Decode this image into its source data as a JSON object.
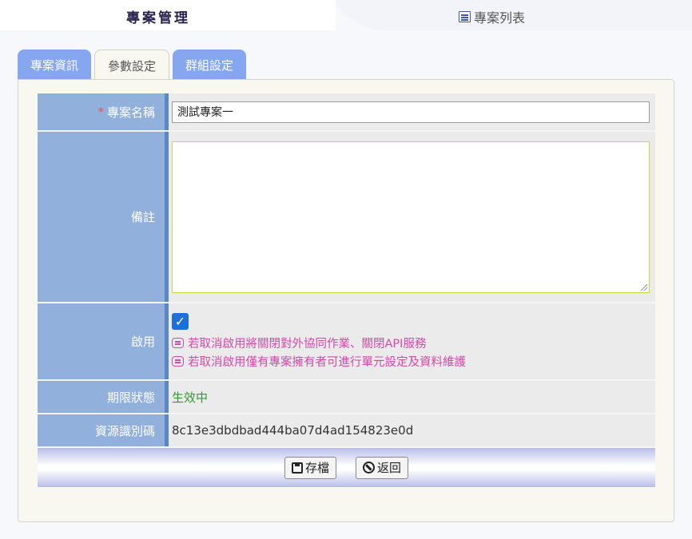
{
  "header": {
    "title": "專案管理",
    "list_link_label": "專案列表"
  },
  "tabs": [
    {
      "label": "專案資訊",
      "state": "inactive"
    },
    {
      "label": "參數設定",
      "state": "active"
    },
    {
      "label": "群組設定",
      "state": "inactive"
    }
  ],
  "form": {
    "name": {
      "required_mark": "*",
      "label": "專案名稱",
      "value": "測試專案一"
    },
    "remark": {
      "label": "備註",
      "value": ""
    },
    "enabled": {
      "label": "啟用",
      "checked": true,
      "notes": [
        "若取消啟用將關閉對外協同作業、關閉API服務",
        "若取消啟用僅有專案擁有者可進行單元設定及資料維護"
      ]
    },
    "expiry": {
      "label": "期限狀態",
      "value": "生效中"
    },
    "resource_id": {
      "label": "資源識別碼",
      "value": "8c13e3dbdbad444ba07d4ad154823e0d"
    }
  },
  "buttons": {
    "save_label": "存檔",
    "back_label": "返回"
  },
  "colors": {
    "tab_blue": "#86a7f0",
    "label_bg": "#91b0dc",
    "note_pink": "#d24aa8",
    "status_green": "#2e9a2e",
    "checkbox_blue": "#1e6fd9"
  }
}
